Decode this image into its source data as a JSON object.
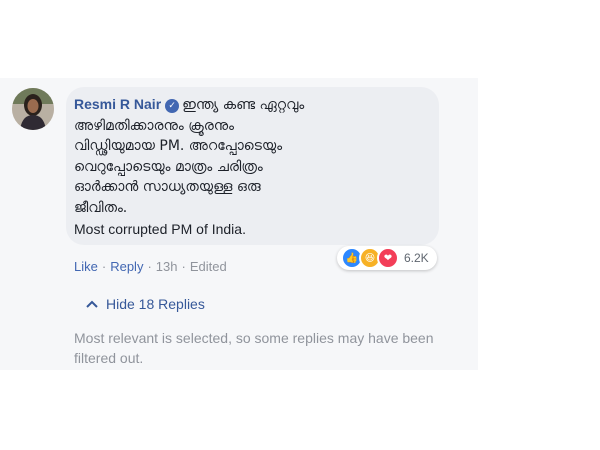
{
  "comment": {
    "author": "Resmi R Nair",
    "lines": [
      "ഇന്ത്യ കണ്ട ഏറ്റവും",
      "അഴിമതിക്കാരനും ക്രൂരനും",
      "വിഡ്ഢിയുമായ PM. അറപ്പോടെയും",
      "വെറുപ്പോടെയും മാത്രം ചരിത്രം",
      "ഓർക്കാൻ സാധ്യതയുള്ള ഒരു",
      "ജീവിതം."
    ],
    "english_line": "Most corrupted PM of India."
  },
  "reactions": {
    "icons": [
      "like-icon",
      "haha-icon",
      "love-icon"
    ],
    "count": "6.2K",
    "colors": {
      "like": "#2d88ff",
      "haha": "#f7b125",
      "love": "#f33e58"
    }
  },
  "actions": {
    "like": "Like",
    "reply": "Reply",
    "time": "13h",
    "edited": "Edited",
    "separator": "·"
  },
  "replies": {
    "hide_label": "Hide 18 Replies",
    "filter_note": "Most relevant is selected, so some replies may have been filtered out."
  }
}
